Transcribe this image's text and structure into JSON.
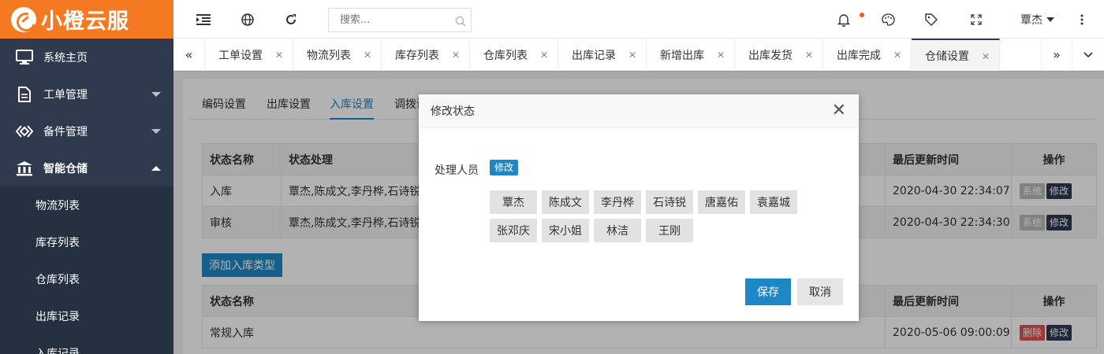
{
  "app": {
    "logo_text": "小橙云服"
  },
  "sidebar": {
    "items": [
      {
        "label": "系统主页",
        "icon": "monitor-icon"
      },
      {
        "label": "工单管理",
        "icon": "document-icon"
      },
      {
        "label": "备件管理",
        "icon": "diamond-link-icon"
      },
      {
        "label": "智能仓储",
        "icon": "bank-icon"
      }
    ],
    "subitems": [
      "物流列表",
      "库存列表",
      "仓库列表",
      "出库记录",
      "入库记录"
    ]
  },
  "header": {
    "search_placeholder": "搜索...",
    "user_name": "覃杰",
    "icons": [
      "menu-fold-icon",
      "globe-icon",
      "refresh-icon",
      "search-icon",
      "bell-icon",
      "palette-icon",
      "tag-icon",
      "fullscreen-icon",
      "more-vertical-icon"
    ]
  },
  "tabs": {
    "items": [
      "工单设置",
      "物流列表",
      "库存列表",
      "仓库列表",
      "出库记录",
      "新增出库",
      "出库发货",
      "出库完成",
      "仓储设置"
    ],
    "active": "仓储设置",
    "prev_glyph": "«",
    "next_glyph": "»",
    "dropdown_glyph": "⌄"
  },
  "content": {
    "subtabs": [
      "编码设置",
      "出库设置",
      "入库设置",
      "调拨设"
    ],
    "active_subtab": "入库设置",
    "table1": {
      "headers": [
        "状态名称",
        "状态处理",
        "最后更新时间",
        "操作"
      ],
      "rows": [
        {
          "name": "入库",
          "handlers": "覃杰,陈成文,李丹桦,石诗锐",
          "time": "2020-04-30 22:34:07",
          "btn1": "系统",
          "btn2": "修改"
        },
        {
          "name": "审核",
          "handlers": "覃杰,陈成文,李丹桦,石诗锐",
          "time": "2020-04-30 22:34:30",
          "btn1": "系统",
          "btn2": "修改"
        }
      ]
    },
    "add_button": "添加入库类型",
    "table2": {
      "headers": [
        "状态名称",
        "最后更新时间",
        "操作"
      ],
      "rows": [
        {
          "name": "常规入库",
          "time": "2020-05-06 09:00:09",
          "btn1": "删除",
          "btn2": "修改"
        }
      ]
    }
  },
  "modal": {
    "title": "修改状态",
    "close_glyph": "✕",
    "field_label": "处理人员",
    "edit_tag": "修改",
    "people": [
      "覃杰",
      "陈成文",
      "李丹桦",
      "石诗锐",
      "唐嘉佑",
      "袁嘉城",
      "张邓庆",
      "宋小姐",
      "林洁",
      "王刚"
    ],
    "save": "保存",
    "cancel": "取消"
  },
  "colors": {
    "brand": "#f47920",
    "sidebar": "#2f3a4f",
    "primary": "#1e88c7",
    "danger": "#e05252"
  }
}
